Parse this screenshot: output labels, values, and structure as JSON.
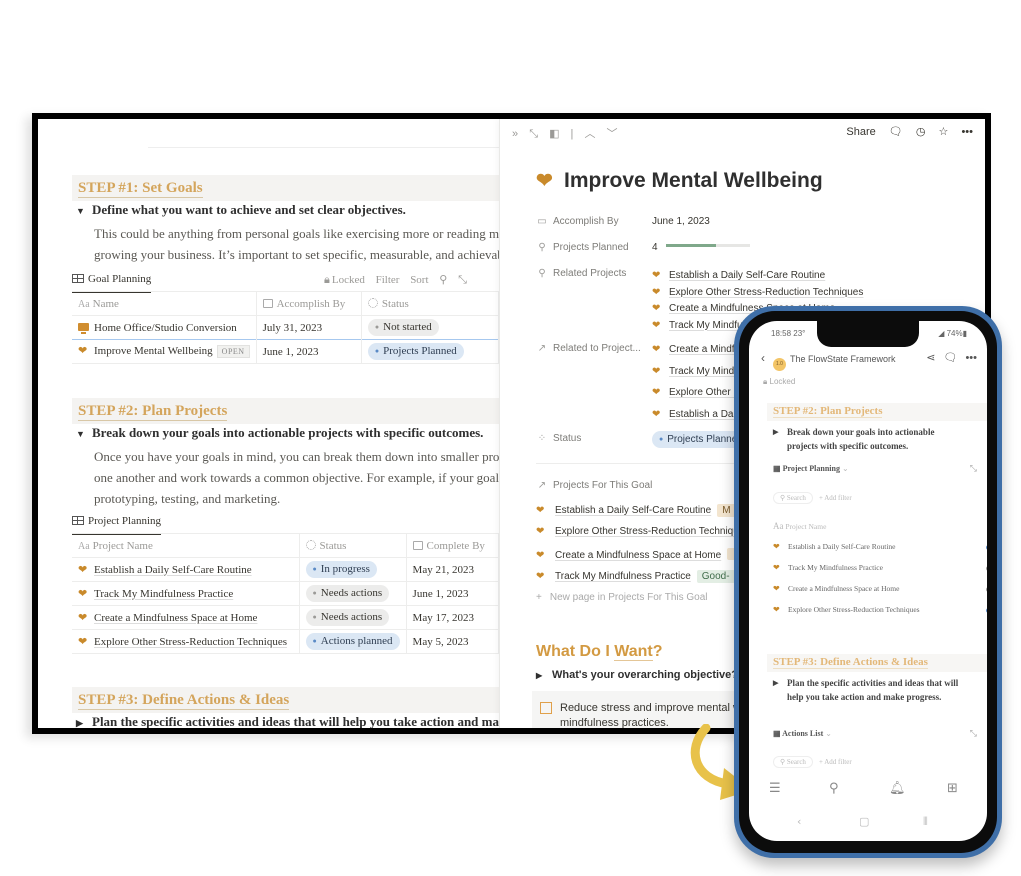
{
  "desktop": {
    "step1": {
      "title": "STEP #1: Set Goals",
      "toggle": "Define what you want to achieve and set clear objectives.",
      "para_lines": [
        "This could be anything from personal goals like exercising more or reading more b",
        "growing your business. It’s important to set specific, measurable, and achievable g"
      ],
      "db": {
        "tab": "Goal Planning",
        "tools": {
          "locked": "Locked",
          "filter": "Filter",
          "sort": "Sort"
        },
        "headers": [
          "Name",
          "Accomplish By",
          "Status"
        ],
        "rows": [
          {
            "name": "Home Office/Studio Conversion",
            "date": "July 31, 2023",
            "status": "Not started",
            "status_color": "gray",
            "icon": "monitor"
          },
          {
            "name": "Improve Mental Wellbeing",
            "date": "June 1, 2023",
            "status": "Projects Planned",
            "status_color": "blue",
            "icon": "heart",
            "open": "OPEN"
          }
        ]
      }
    },
    "step2": {
      "title": "STEP #2: Plan Projects",
      "toggle": "Break down your goals into actionable projects with specific outcomes.",
      "para_lines": [
        "Once you have your goals in mind, you can break them down into smaller projects",
        "one another and work towards a common objective. For example, if your goal is to",
        "prototyping, testing, and marketing."
      ],
      "db": {
        "tab": "Project Planning",
        "headers": [
          "Project Name",
          "Status",
          "Complete By"
        ],
        "rows": [
          {
            "name": "Establish a Daily Self-Care Routine",
            "status": "In progress",
            "status_color": "blue",
            "date": "May 21, 2023"
          },
          {
            "name": "Track My Mindfulness Practice",
            "status": "Needs actions",
            "status_color": "gray",
            "date": "June 1, 2023"
          },
          {
            "name": "Create a Mindfulness Space at Home",
            "status": "Needs actions",
            "status_color": "gray",
            "date": "May 17, 2023"
          },
          {
            "name": "Explore Other Stress-Reduction Techniques",
            "status": "Actions planned",
            "status_color": "blue",
            "date": "May 5, 2023"
          }
        ]
      }
    },
    "step3": {
      "title": "STEP #3: Define Actions & Ideas",
      "toggle": "Plan the specific activities and ideas that will help you take action and make p"
    },
    "peek": {
      "toolbar": {
        "share": "Share"
      },
      "title": "Improve Mental Wellbeing",
      "props": {
        "accomplish_by": {
          "label": "Accomplish By",
          "value": "June 1, 2023"
        },
        "projects_planned": {
          "label": "Projects Planned",
          "value": "4",
          "progress_fraction": 0.6
        },
        "related_projects": {
          "label": "Related Projects",
          "items": [
            "Establish a Daily Self-Care Routine",
            "Explore Other Stress-Reduction Techniques",
            "Create a Mindfulness Space at Home",
            "Track My Mindfulness Practice"
          ]
        },
        "related_to_project": {
          "label": "Related to Project...",
          "items": [
            "Create a Mindfulness Space at Home",
            "Track My Mindfulness Practice",
            "Explore Other Stress-Reduction Techniques",
            "Establish a Daily Self-Care Routine"
          ]
        },
        "status": {
          "label": "Status",
          "value": "Projects Planned"
        }
      },
      "projects_for_goal": {
        "label": "Projects For This Goal",
        "items": [
          {
            "name": "Establish a Daily Self-Care Routine",
            "tag": "M",
            "tag_color": "tan"
          },
          {
            "name": "Explore Other Stress-Reduction Techniques",
            "tag": "",
            "tag_color": ""
          },
          {
            "name": "Create a Mindfulness Space at Home",
            "tag": "",
            "tag_color": "tan"
          },
          {
            "name": "Track My Mindfulness Practice",
            "tag": "Good-",
            "tag_color": "green"
          }
        ],
        "new_page": "New page in Projects For This Goal"
      },
      "what_do_i_want": {
        "title_a": "What Do I ",
        "title_b": "Want",
        "title_c": "?"
      },
      "objective_toggle": "What's your overarching objective?",
      "callout_lines": [
        "Reduce stress and improve mental w",
        "mindfulness practices."
      ]
    }
  },
  "phone": {
    "status": {
      "time": "18:58",
      "temp": "23°",
      "battery": "74%"
    },
    "nav": {
      "avatar": "1.0",
      "title": "The FlowState Framework"
    },
    "locked": "Locked",
    "step2": {
      "title": "STEP #2: Plan Projects",
      "toggle": "Break down your goals into actionable projects with specific outcomes.",
      "db": "Project Planning",
      "search": "Search",
      "add_filter": "Add filter",
      "header": "Project Name",
      "rows": [
        {
          "name": "Establish a Daily Self-Care Routine",
          "dot": "#5a8ac6"
        },
        {
          "name": "Track My Mindfulness Practice",
          "dot": "#9b9a97"
        },
        {
          "name": "Create a Mindfulness Space at Home",
          "dot": "#9b9a97"
        },
        {
          "name": "Explore Other Stress-Reduction Techniques",
          "dot": "#5a8ac6"
        }
      ]
    },
    "step3": {
      "title": "STEP #3: Define Actions & Ideas",
      "toggle": "Plan the specific activities and ideas that will help you take action and make progress.",
      "db": "Actions List",
      "search": "Search",
      "add_filter": "Add filter"
    }
  }
}
